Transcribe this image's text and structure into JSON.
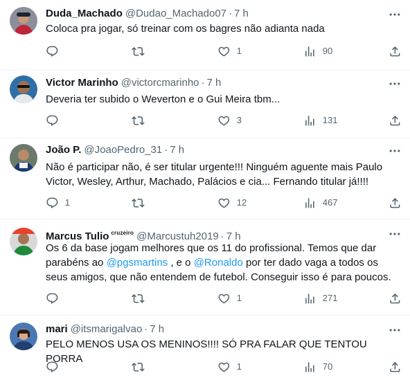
{
  "colors": {
    "text": "#0f1419",
    "secondary": "#536471",
    "link": "#1d9bf0",
    "divider": "#eff3f4"
  },
  "icons": {
    "reply": "reply-icon",
    "retweet": "retweet-icon",
    "like": "heart-icon",
    "views": "views-icon",
    "share": "share-icon",
    "more": "more-icon"
  },
  "tweets": [
    {
      "name": "Duda_Machado",
      "badge": "",
      "handle": "@Dudao_Machado07",
      "dot": "·",
      "time": "7 h",
      "text": "Coloca pra jogar, só treinar com os bagres não adianta nada",
      "replies": "",
      "retweets": "",
      "likes": "1",
      "views": "90"
    },
    {
      "name": "Victor Marinho",
      "badge": "",
      "handle": "@victorcmarinho",
      "dot": "·",
      "time": "7 h",
      "text": "Deveria ter subido o Weverton e o Gui Meira tbm...",
      "replies": "",
      "retweets": "",
      "likes": "3",
      "views": "131"
    },
    {
      "name": "João P.",
      "badge": "",
      "handle": "@JoaoPedro_31",
      "dot": "·",
      "time": "7 h",
      "text": "Não é participar não, é ser titular urgente!!! Ninguém aguente mais Paulo Victor, Wesley, Arthur, Machado, Palácios e cia... Fernando titular já!!!!",
      "replies": "1",
      "retweets": "",
      "likes": "12",
      "views": "467"
    },
    {
      "name": "Marcus Tulio",
      "badge": "cruzeiro",
      "handle": "@Marcustuh2019",
      "dot": "·",
      "time": "7 h",
      "text_parts": [
        "Os 6 da base jogam melhores que os 11 do profissional. Temos que dar parabéns ao ",
        "@pgsmartins",
        " , e o ",
        "@Ronaldo",
        " por ter dado vaga a todos os seus amigos, que não entendem de futebol. Conseguir isso é para poucos."
      ],
      "replies": "",
      "retweets": "",
      "likes": "1",
      "views": "271"
    },
    {
      "name": "mari",
      "badge": "",
      "handle": "@itsmarigalvao",
      "dot": "·",
      "time": "7 h",
      "text": "PELO MENOS USA OS MENINOS!!!! SÓ PRA FALAR QUE TENTOU PORRA",
      "replies": "",
      "retweets": "",
      "likes": "1",
      "views": "70"
    }
  ]
}
